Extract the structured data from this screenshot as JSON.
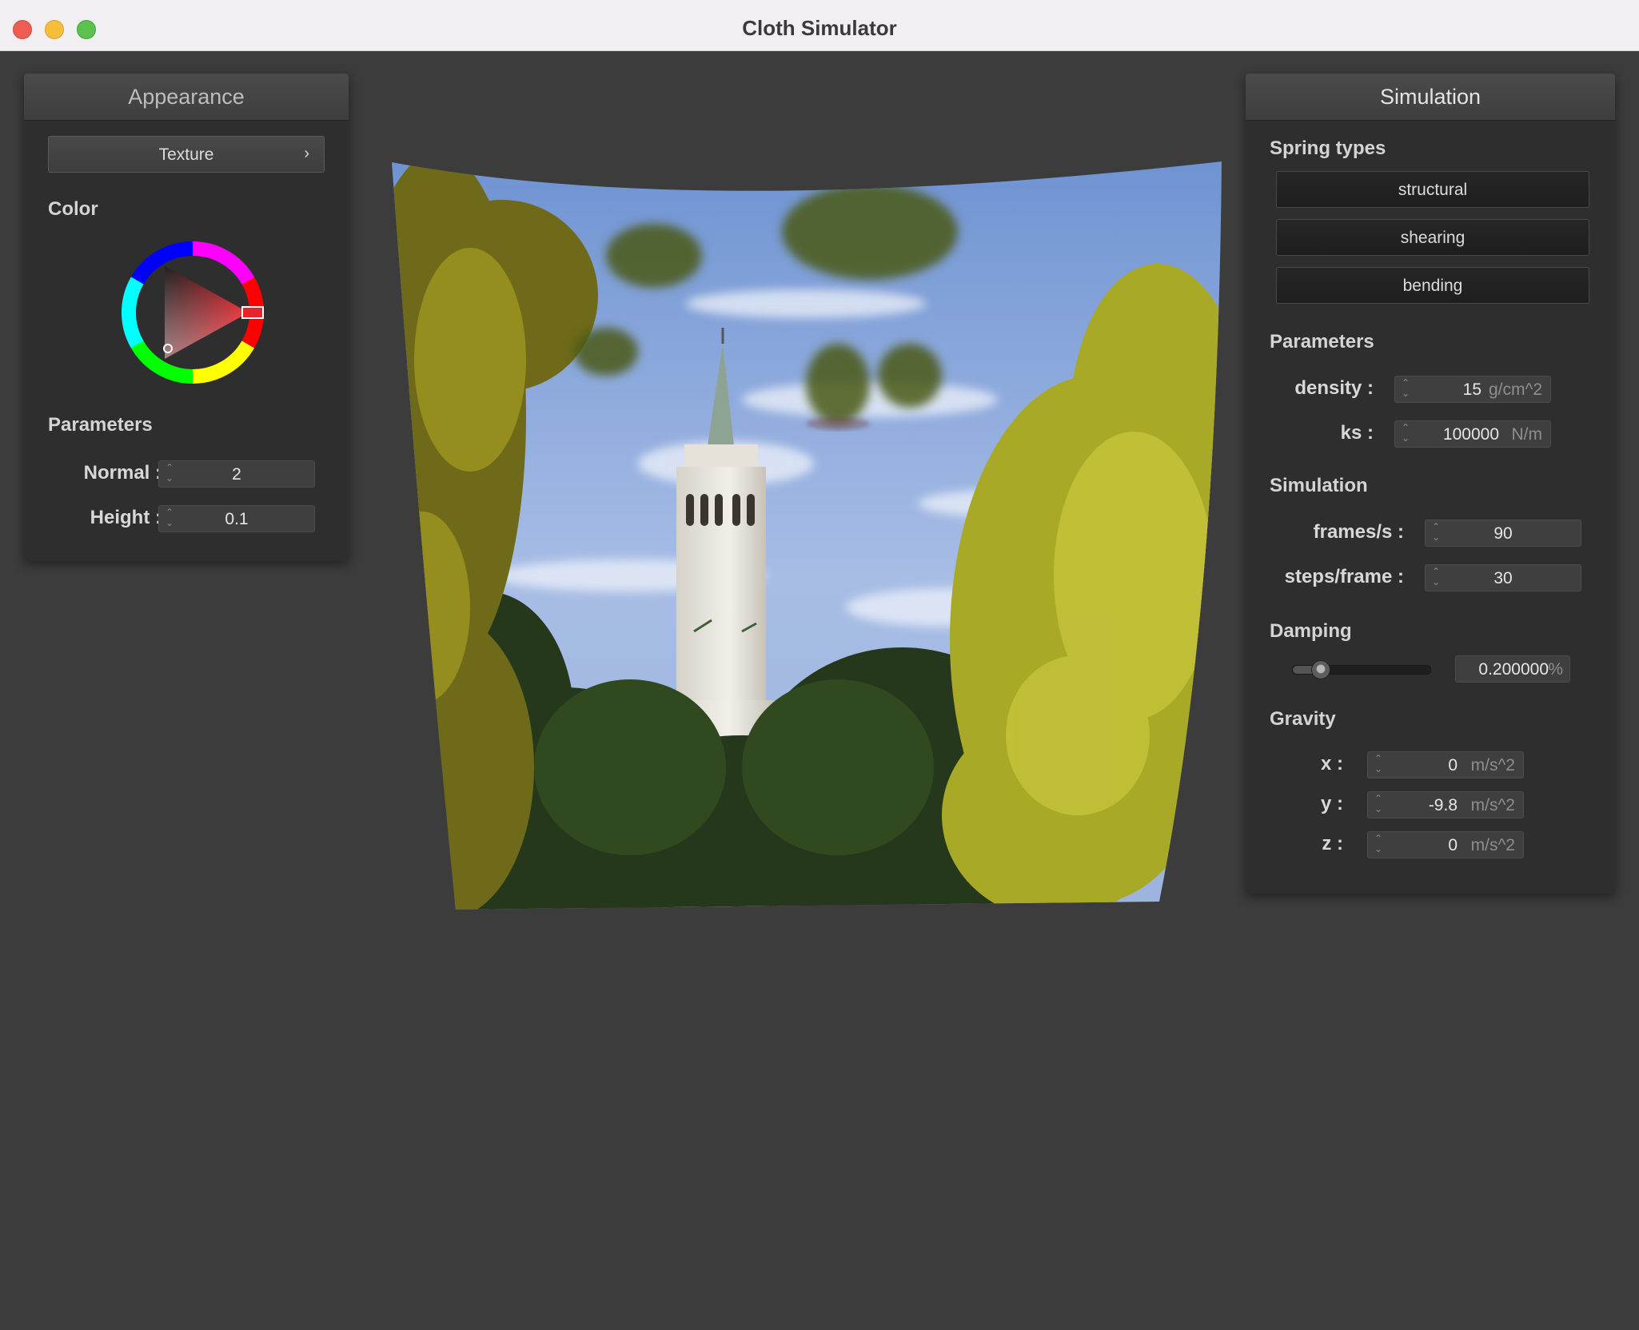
{
  "window": {
    "title": "Cloth Simulator"
  },
  "appearance": {
    "header": "Appearance",
    "texture_button": "Texture",
    "texture_chevron": "›",
    "color_label": "Color",
    "selected_color": "#e8232b",
    "parameters_label": "Parameters",
    "normal": {
      "label": "Normal :",
      "value": "2"
    },
    "height": {
      "label": "Height :",
      "value": "0.1"
    }
  },
  "simulation": {
    "header": "Simulation",
    "spring_types_label": "Spring types",
    "springs": [
      "structural",
      "shearing",
      "bending"
    ],
    "parameters_label": "Parameters",
    "density": {
      "label": "density :",
      "value": "15",
      "unit": "g/cm^2"
    },
    "ks": {
      "label": "ks :",
      "value": "100000",
      "unit": "N/m"
    },
    "simulation_label": "Simulation",
    "frames": {
      "label": "frames/s :",
      "value": "90"
    },
    "steps": {
      "label": "steps/frame :",
      "value": "30"
    },
    "damping_label": "Damping",
    "damping": {
      "value": "0.200000",
      "unit": "%",
      "slider_fraction": 0.2
    },
    "gravity_label": "Gravity",
    "gravity": [
      {
        "label": "x :",
        "value": "0",
        "unit": "m/s^2"
      },
      {
        "label": "y :",
        "value": "-9.8",
        "unit": "m/s^2"
      },
      {
        "label": "z :",
        "value": "0",
        "unit": "m/s^2"
      }
    ]
  },
  "icons": {
    "spinner": "updown-arrows-icon",
    "chevron": "chevron-right-icon"
  }
}
